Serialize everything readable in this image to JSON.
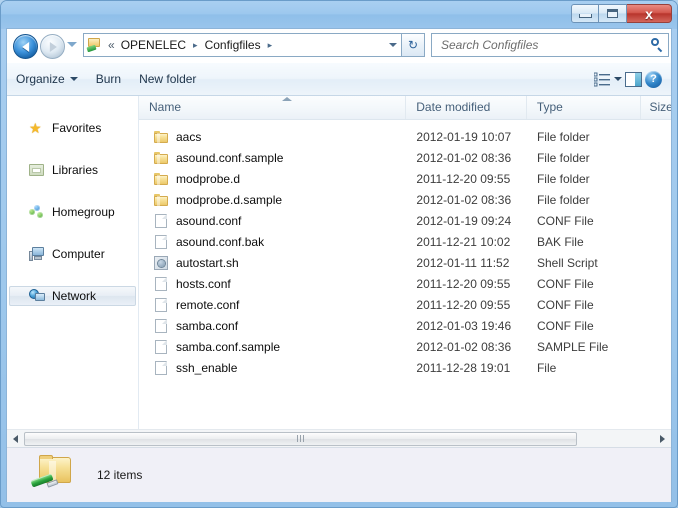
{
  "window": {
    "minimize_label": "Minimize",
    "maximize_label": "Maximize",
    "close_label": "x"
  },
  "address_bar": {
    "back_label": "Back",
    "forward_label": "Forward",
    "history_label": "Recent pages",
    "overflow_chevron": "«",
    "crumbs": [
      "OPENELEC",
      "Configfiles"
    ],
    "separator": "▸",
    "refresh_label": "↻"
  },
  "search": {
    "placeholder": "Search Configfiles",
    "value": ""
  },
  "toolbar": {
    "organize_label": "Organize",
    "burn_label": "Burn",
    "new_folder_label": "New folder",
    "help_label": "?"
  },
  "sidebar": {
    "items": [
      {
        "label": "Favorites",
        "icon": "star-icon",
        "selected": false
      },
      {
        "label": "Libraries",
        "icon": "library-folder-icon",
        "selected": false
      },
      {
        "label": "Homegroup",
        "icon": "homegroup-icon",
        "selected": false
      },
      {
        "label": "Computer",
        "icon": "computer-icon",
        "selected": false
      },
      {
        "label": "Network",
        "icon": "network-icon",
        "selected": true
      }
    ]
  },
  "file_list": {
    "columns": [
      "Name",
      "Date modified",
      "Type",
      "Size"
    ],
    "sort_column": "Name",
    "sort_direction": "ascending",
    "rows": [
      {
        "name": "aacs",
        "date": "2012-01-19 10:07",
        "type": "File folder",
        "size": "",
        "icon": "folder-icon"
      },
      {
        "name": "asound.conf.sample",
        "date": "2012-01-02 08:36",
        "type": "File folder",
        "size": "",
        "icon": "folder-icon"
      },
      {
        "name": "modprobe.d",
        "date": "2011-12-20 09:55",
        "type": "File folder",
        "size": "",
        "icon": "folder-icon"
      },
      {
        "name": "modprobe.d.sample",
        "date": "2012-01-02 08:36",
        "type": "File folder",
        "size": "",
        "icon": "folder-icon"
      },
      {
        "name": "asound.conf",
        "date": "2012-01-19 09:24",
        "type": "CONF File",
        "size": "",
        "icon": "file-icon"
      },
      {
        "name": "asound.conf.bak",
        "date": "2011-12-21 10:02",
        "type": "BAK File",
        "size": "",
        "icon": "file-icon"
      },
      {
        "name": "autostart.sh",
        "date": "2012-01-11 11:52",
        "type": "Shell Script",
        "size": "",
        "icon": "shell-script-icon"
      },
      {
        "name": "hosts.conf",
        "date": "2011-12-20 09:55",
        "type": "CONF File",
        "size": "",
        "icon": "file-icon"
      },
      {
        "name": "remote.conf",
        "date": "2011-12-20 09:55",
        "type": "CONF File",
        "size": "",
        "icon": "file-icon"
      },
      {
        "name": "samba.conf",
        "date": "2012-01-03 19:46",
        "type": "CONF File",
        "size": "",
        "icon": "file-icon"
      },
      {
        "name": "samba.conf.sample",
        "date": "2012-01-02 08:36",
        "type": "SAMPLE File",
        "size": "",
        "icon": "file-icon"
      },
      {
        "name": "ssh_enable",
        "date": "2011-12-28 19:01",
        "type": "File",
        "size": "",
        "icon": "file-icon"
      }
    ]
  },
  "status_bar": {
    "item_count": "12 items"
  },
  "colors": {
    "title_bar": "#9dc8ee",
    "window_border": "#6a9cc9",
    "close_button": "#c4453b",
    "selection": "#e8f3fd",
    "column_header_text": "#46607a",
    "status_bar_bg": "#f0f0f7"
  }
}
